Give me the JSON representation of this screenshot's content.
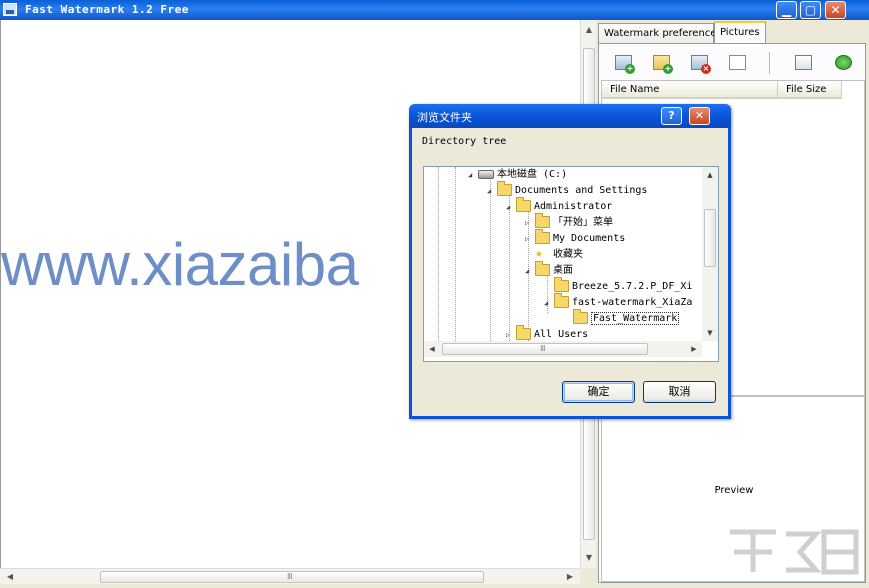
{
  "window": {
    "title": "Fast Watermark 1.2 Free",
    "minimize_glyph": "▁",
    "maximize_glyph": "▢",
    "close_glyph": "✕"
  },
  "canvas": {
    "watermark_text": "www.xiazaiba"
  },
  "tabs": [
    {
      "label": "Watermark preferences",
      "active": false
    },
    {
      "label": "Pictures",
      "active": true
    }
  ],
  "toolbar": {
    "icons": [
      "add-picture-icon",
      "add-folder-icon",
      "remove-picture-icon",
      "clear-list-icon",
      "edit-icon",
      "apply-check-icon"
    ]
  },
  "file_list": {
    "columns": [
      "File Name",
      "File Size"
    ]
  },
  "preview": {
    "label": "Preview"
  },
  "dialog": {
    "title": "浏览文件夹",
    "help_glyph": "?",
    "close_glyph": "✕",
    "label": "Directory tree",
    "tree": [
      {
        "label": "本地磁盘 (C:)",
        "icon": "drive-icon",
        "toggle": "◢"
      },
      {
        "label": "Documents and Settings",
        "icon": "folder-icon",
        "toggle": "◢"
      },
      {
        "label": "Administrator",
        "icon": "folder-icon",
        "toggle": "◢"
      },
      {
        "label": "「开始」菜单",
        "icon": "folder-icon",
        "toggle": "▷"
      },
      {
        "label": "My Documents",
        "icon": "folder-icon",
        "toggle": "▷"
      },
      {
        "label": "收藏夹",
        "icon": "star-icon",
        "toggle": ""
      },
      {
        "label": "桌面",
        "icon": "folder-icon",
        "toggle": "◢"
      },
      {
        "label": "Breeze_5.7.2.P_DF_Xi",
        "icon": "folder-icon",
        "toggle": ""
      },
      {
        "label": "fast-watermark_XiaZa",
        "icon": "folder-icon",
        "toggle": "◢"
      },
      {
        "label": "Fast_Watermark",
        "icon": "folder-icon",
        "toggle": "",
        "selected": true
      },
      {
        "label": "All Users",
        "icon": "folder-icon",
        "toggle": "▷"
      }
    ],
    "ok_label": "确定",
    "cancel_label": "取消"
  },
  "scroll_grip": "Ⅲ",
  "colors": {
    "titlebar": "#0a5fd8",
    "watermark_text": "#6d8ec6",
    "selected_tab_accent": "#ffc83c",
    "dialog_frame": "#0a54dc"
  }
}
